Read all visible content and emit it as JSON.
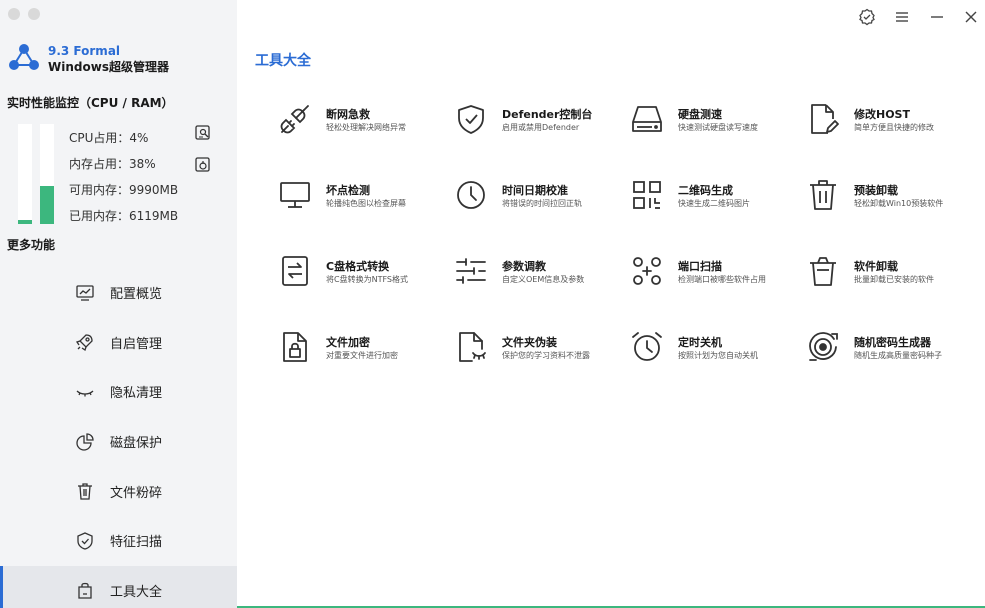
{
  "app": {
    "version": "9.3 Formal",
    "name": "Windows超级管理器"
  },
  "perf": {
    "title": "实时性能监控（CPU / RAM）",
    "cpu_percent": 4,
    "ram_percent": 38,
    "cpu_label": "CPU占用：4%",
    "ram_label": "内存占用：38%",
    "avail_label": "可用内存：9990MB",
    "used_label": "已用内存：6119MB"
  },
  "more_title": "更多功能",
  "nav": [
    {
      "label": "配置概览",
      "icon": "monitor-chart-icon"
    },
    {
      "label": "自启管理",
      "icon": "rocket-icon"
    },
    {
      "label": "隐私清理",
      "icon": "eye-closed-icon"
    },
    {
      "label": "磁盘保护",
      "icon": "pie-chart-icon"
    },
    {
      "label": "文件粉碎",
      "icon": "trash-icon"
    },
    {
      "label": "特征扫描",
      "icon": "shield-check-icon"
    },
    {
      "label": "工具大全",
      "icon": "bag-icon"
    }
  ],
  "active_nav": "工具大全",
  "main": {
    "title": "工具大全"
  },
  "tools": [
    {
      "title": "断网急救",
      "desc": "轻松处理解决网络异常",
      "icon": "plug-icon"
    },
    {
      "title": "Defender控制台",
      "desc": "启用或禁用Defender",
      "icon": "shield-check-icon"
    },
    {
      "title": "硬盘测速",
      "desc": "快速测试硬盘读写速度",
      "icon": "hard-drive-icon"
    },
    {
      "title": "修改HOST",
      "desc": "简单方便且快捷的修改",
      "icon": "file-edit-icon"
    },
    {
      "title": "坏点检测",
      "desc": "轮播纯色图以检查屏幕",
      "icon": "monitor-icon"
    },
    {
      "title": "时间日期校准",
      "desc": "将错误的时间拉回正轨",
      "icon": "clock-icon"
    },
    {
      "title": "二维码生成",
      "desc": "快速生成二维码图片",
      "icon": "qrcode-icon"
    },
    {
      "title": "预装卸载",
      "desc": "轻松卸载Win10预装软件",
      "icon": "trash-icon"
    },
    {
      "title": "C盘格式转换",
      "desc": "将C盘转换为NTFS格式",
      "icon": "convert-file-icon"
    },
    {
      "title": "参数调教",
      "desc": "自定义OEM信息及参数",
      "icon": "sliders-icon"
    },
    {
      "title": "端口扫描",
      "desc": "检测端口被哪些软件占用",
      "icon": "port-scan-icon"
    },
    {
      "title": "软件卸载",
      "desc": "批量卸载已安装的软件",
      "icon": "bin-icon"
    },
    {
      "title": "文件加密",
      "desc": "对重要文件进行加密",
      "icon": "file-lock-icon"
    },
    {
      "title": "文件夹伪装",
      "desc": "保护您的学习资料不泄露",
      "icon": "file-hidden-icon"
    },
    {
      "title": "定时关机",
      "desc": "按照计划为您自动关机",
      "icon": "alarm-icon"
    },
    {
      "title": "随机密码生成器",
      "desc": "随机生成高质量密码种子",
      "icon": "target-icon"
    }
  ],
  "colors": {
    "accent": "#2b6cd4",
    "bar_fill": "#3cb77e",
    "sidebar_bg": "#f3f4f6"
  }
}
